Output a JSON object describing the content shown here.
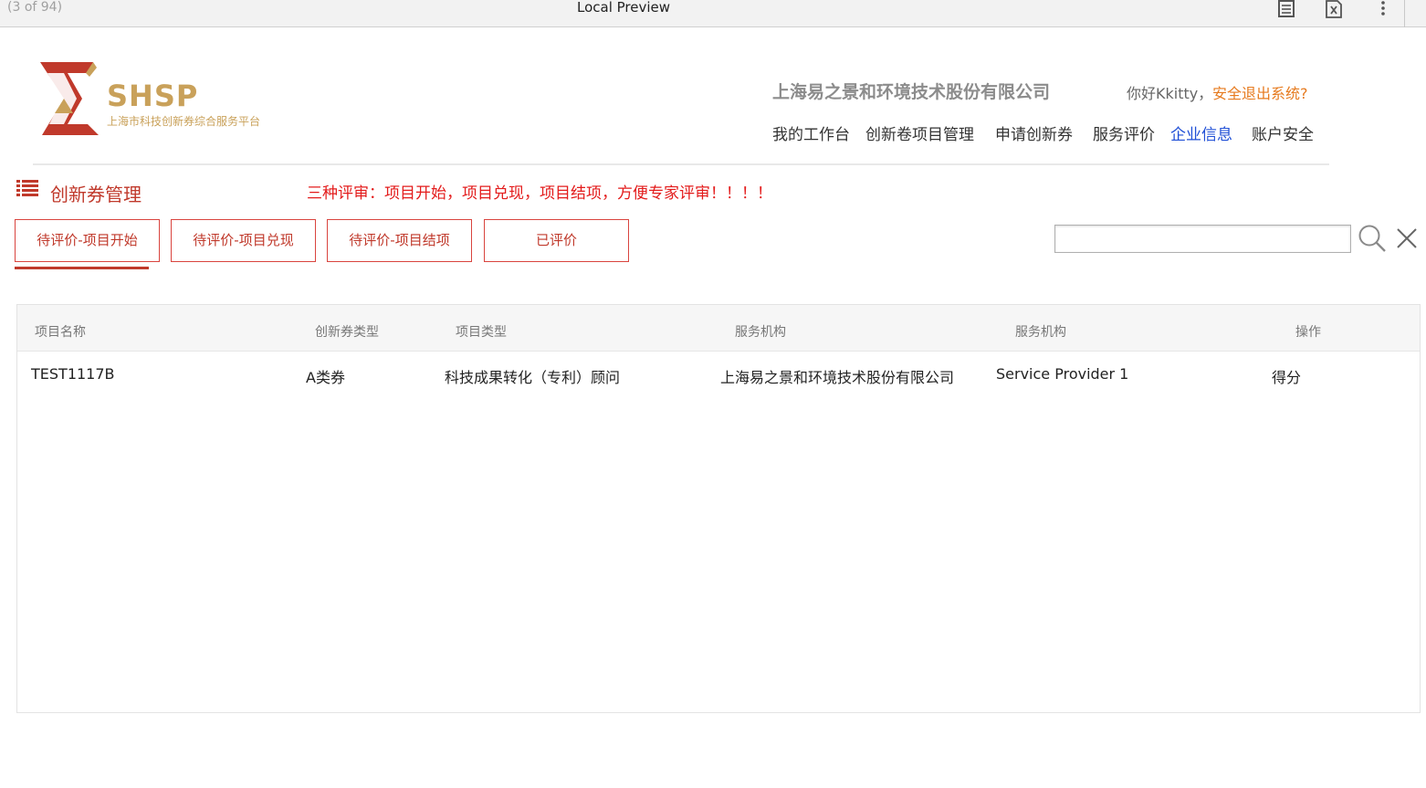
{
  "preview_bar": {
    "counter": "(3 of 94)",
    "title": "Local Preview",
    "icons": [
      "document-icon",
      "excel-icon",
      "more-vertical-icon"
    ]
  },
  "header": {
    "logo_text": "SHSP",
    "logo_subtitle": "上海市科技创新券综合服务平台",
    "company_name": "上海易之景和环境技术股份有限公司",
    "greeting": "你好Kkitty，",
    "logout_label": "安全退出系统?",
    "nav": [
      {
        "label": "我的工作台",
        "active": false
      },
      {
        "label": "创新卷项目管理",
        "active": false
      },
      {
        "label": "申请创新券",
        "active": false
      },
      {
        "label": "服务评价",
        "active": false
      },
      {
        "label": "企业信息",
        "active": true
      },
      {
        "label": "账户安全",
        "active": false
      }
    ]
  },
  "section": {
    "title": "创新券管理",
    "notice": "三种评审：项目开始，项目兑现，项目结项，方便专家评审！！！！"
  },
  "tabs": [
    {
      "label": "待评价-项目开始",
      "active": true
    },
    {
      "label": "待评价-项目兑现",
      "active": false
    },
    {
      "label": "待评价-项目结项",
      "active": false
    },
    {
      "label": "已评价",
      "active": false
    }
  ],
  "search": {
    "value": "",
    "placeholder": ""
  },
  "table": {
    "columns": [
      "项目名称",
      "创新券类型",
      "项目类型",
      "服务机构",
      "服务机构",
      "操作"
    ],
    "rows": [
      [
        "TEST1117B",
        "A类券",
        "科技成果转化（专利）顾问",
        "上海易之景和环境技术股份有限公司",
        "Service Provider 1",
        "得分"
      ]
    ]
  },
  "colors": {
    "brand_red": "#c0392b",
    "notice_red": "#e31b1b",
    "logout_orange": "#e67a1e",
    "nav_active_blue": "#1f4fd6",
    "logo_gold": "#c9a15a"
  }
}
